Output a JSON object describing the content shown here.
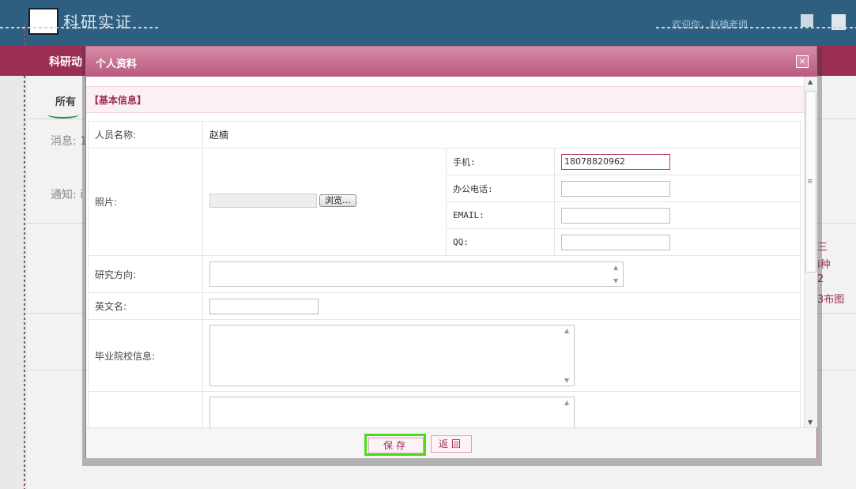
{
  "app": {
    "title": "科研实证",
    "welcome": "欢迎你，赵楠老师",
    "menu_title": "科研动",
    "tab_all": "所有",
    "label_messages": "消息: 1",
    "label_notices": "通知: i",
    "right_links": [
      "三",
      "i种",
      "2",
      "3布图"
    ]
  },
  "modal": {
    "title": "个人资料",
    "close_icon": "×",
    "section_title": "【基本信息】",
    "fields": {
      "name_label": "人员名称:",
      "name_value": "赵楠",
      "photo_label": "照片:",
      "browse_label": "浏览...",
      "mobile_label": "手机:",
      "mobile_value": "18078820962",
      "office_phone_label": "办公电话:",
      "office_phone_value": "",
      "email_label": "EMAIL:",
      "email_value": "",
      "qq_label": "QQ:",
      "qq_value": "",
      "research_label": "研究方向:",
      "research_value": "",
      "english_name_label": "英文名:",
      "english_name_value": "",
      "graduate_label": "毕业院校信息:",
      "graduate_value": ""
    },
    "buttons": {
      "save": "保存",
      "back": "返回"
    }
  }
}
